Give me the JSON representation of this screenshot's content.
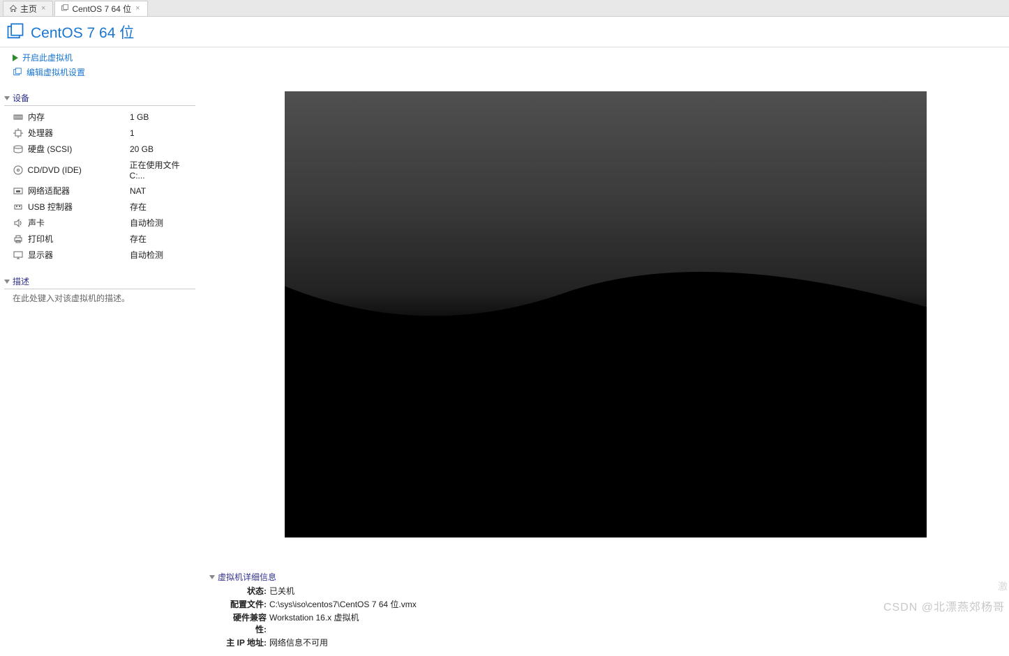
{
  "tabs": {
    "home": "主页",
    "vm": "CentOS 7 64 位"
  },
  "title": "CentOS 7 64 位",
  "actions": {
    "power_on": "开启此虚拟机",
    "edit_settings": "编辑虚拟机设置"
  },
  "sections": {
    "devices": "设备",
    "description": "描述",
    "vm_details": "虚拟机详细信息"
  },
  "devices": {
    "memory": {
      "label": "内存",
      "value": "1 GB"
    },
    "cpu": {
      "label": "处理器",
      "value": "1"
    },
    "disk": {
      "label": "硬盘 (SCSI)",
      "value": "20 GB"
    },
    "cd": {
      "label": "CD/DVD (IDE)",
      "value": "正在使用文件 C:..."
    },
    "net": {
      "label": "网络适配器",
      "value": "NAT"
    },
    "usb": {
      "label": "USB 控制器",
      "value": "存在"
    },
    "sound": {
      "label": "声卡",
      "value": "自动检测"
    },
    "printer": {
      "label": "打印机",
      "value": "存在"
    },
    "display": {
      "label": "显示器",
      "value": "自动检测"
    }
  },
  "description_placeholder": "在此处键入对该虚拟机的描述。",
  "details": {
    "state": {
      "k": "状态:",
      "v": "已关机"
    },
    "config": {
      "k": "配置文件:",
      "v": "C:\\sys\\iso\\centos7\\CentOS 7 64 位.vmx"
    },
    "compat": {
      "k": "硬件兼容性:",
      "v": "Workstation 16.x 虚拟机"
    },
    "ip": {
      "k": "主 IP 地址:",
      "v": "网络信息不可用"
    }
  },
  "watermark": "CSDN @北漂燕郊杨哥",
  "activate": "激"
}
